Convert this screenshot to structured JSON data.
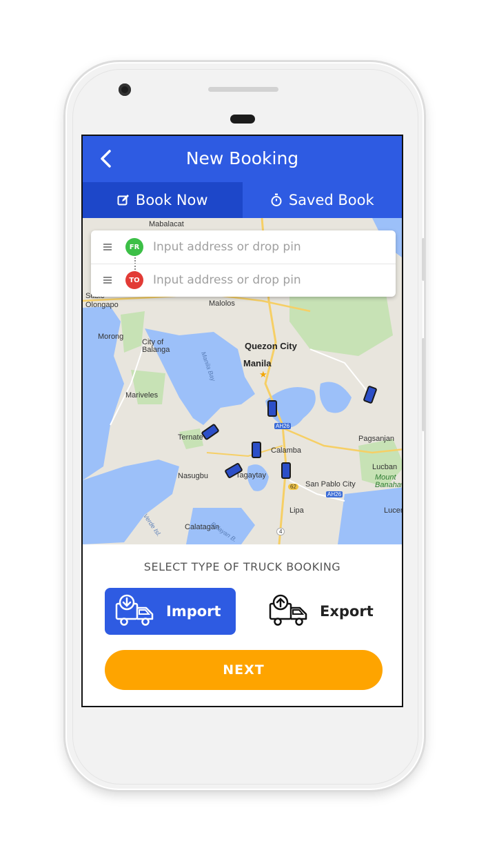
{
  "header": {
    "title": "New Booking"
  },
  "tabs": [
    {
      "label": "Book Now",
      "icon": "edit-icon",
      "active": true
    },
    {
      "label": "Saved Book",
      "icon": "stopwatch-icon",
      "active": false
    }
  ],
  "address": {
    "from_badge": "FR",
    "to_badge": "TO",
    "from_placeholder": "Input address or drop pin",
    "to_placeholder": "Input address or drop pin"
  },
  "map": {
    "labels": {
      "mabalacat": "Mabalacat",
      "olongapo": "Olongapo",
      "malolos": "Malolos",
      "quezon_city": "Quezon City",
      "manila": "Manila",
      "morong": "Morong",
      "city_of_balanga": "City of\nBalanga",
      "mariveles": "Mariveles",
      "manila_bay": "Manila Bay",
      "ternate": "Ternate",
      "nasugbu": "Nasugbu",
      "tagaytay": "Tagaytay",
      "calamba": "Calamba",
      "san_pablo_city": "San Pablo City",
      "pagsanjan": "Pagsanjan",
      "lucban": "Lucban",
      "mount_banahaw": "Mount\nBanahaw",
      "lucena": "Lucen",
      "lipa": "Lipa",
      "calatagan": "Calatagan",
      "balayan_bay": "Balayan B.",
      "verde_isl": "Verde Isl.",
      "subic": "Subic",
      "route_ah26_a": "AH26",
      "route_ah26_b": "AH26",
      "route_62": "62",
      "route_4": "4"
    }
  },
  "booking_type": {
    "prompt": "SELECT TYPE OF TRUCK BOOKING",
    "options": [
      {
        "label": "Import",
        "icon": "truck-import-icon",
        "selected": true
      },
      {
        "label": "Export",
        "icon": "truck-export-icon",
        "selected": false
      }
    ]
  },
  "next_label": "NEXT",
  "colors": {
    "primary": "#2e5be2",
    "primary_dark": "#1d47c9",
    "accent": "#fea400",
    "from": "#3cbf47",
    "to": "#e23b36"
  }
}
